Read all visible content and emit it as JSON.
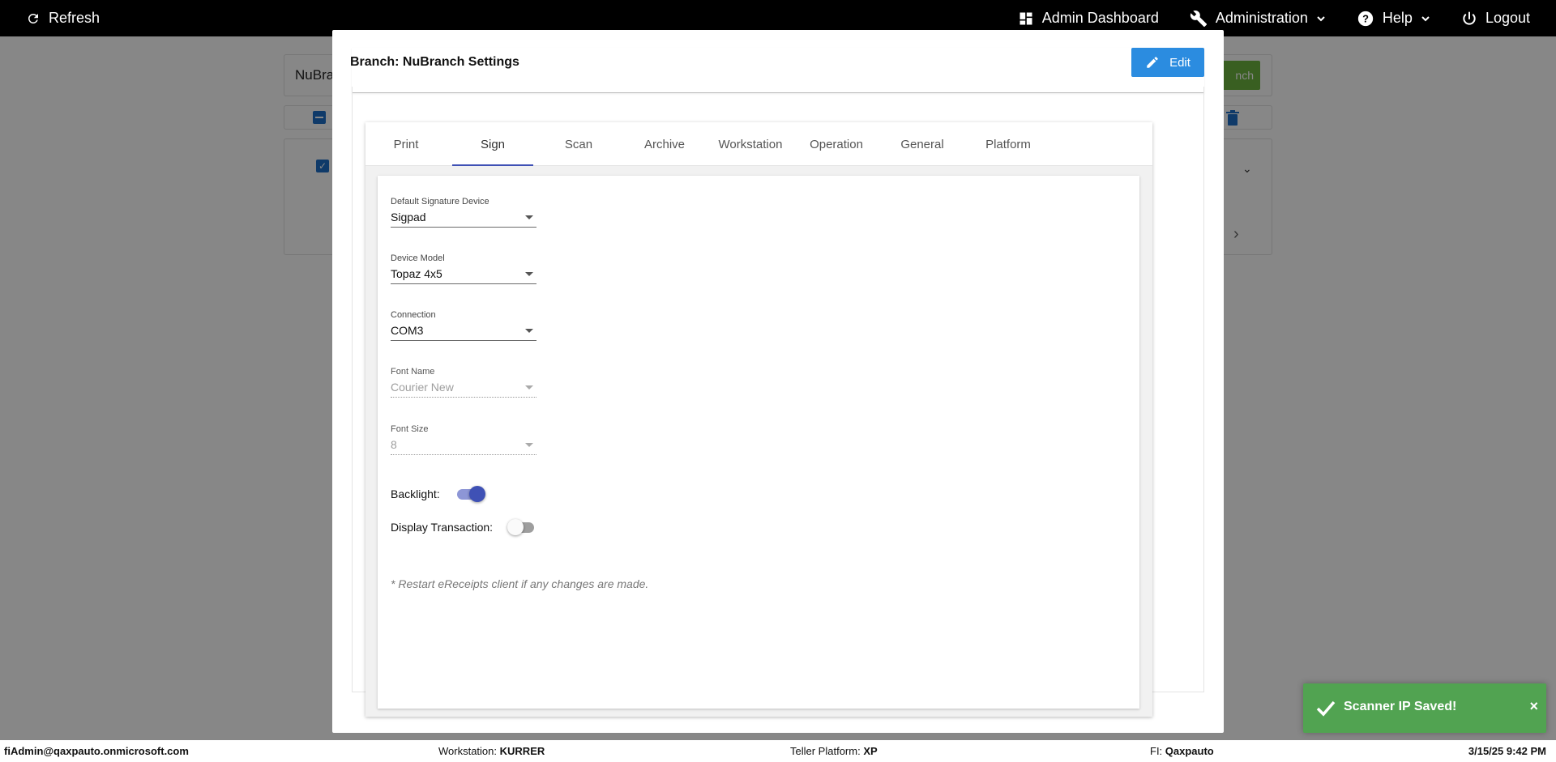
{
  "topbar": {
    "refresh_label": "Refresh",
    "admin_dashboard_label": "Admin Dashboard",
    "administration_label": "Administration",
    "help_label": "Help",
    "logout_label": "Logout"
  },
  "background": {
    "search_value": "NuBra",
    "green_button_label": "nch"
  },
  "modal": {
    "title": "Branch: NuBranch Settings",
    "edit_label": "Edit",
    "tabs": [
      {
        "label": "Print"
      },
      {
        "label": "Sign"
      },
      {
        "label": "Scan"
      },
      {
        "label": "Archive"
      },
      {
        "label": "Workstation"
      },
      {
        "label": "Operation"
      },
      {
        "label": "General"
      },
      {
        "label": "Platform"
      }
    ],
    "active_tab": "Sign",
    "fields": {
      "default_signature_device": {
        "label": "Default Signature Device",
        "value": "Sigpad"
      },
      "device_model": {
        "label": "Device Model",
        "value": "Topaz 4x5"
      },
      "connection": {
        "label": "Connection",
        "value": "COM3"
      },
      "font_name": {
        "label": "Font Name",
        "value": "Courier New"
      },
      "font_size": {
        "label": "Font Size",
        "value": "8"
      }
    },
    "toggles": {
      "backlight": {
        "label": "Backlight:",
        "on": true
      },
      "display_transaction": {
        "label": "Display Transaction:",
        "on": false
      }
    },
    "note": "* Restart eReceipts client if any changes are made."
  },
  "toast": {
    "message": "Scanner IP Saved!",
    "close": "×",
    "color": "#51a351"
  },
  "footer": {
    "user": "fiAdmin@qaxpauto.onmicrosoft.com",
    "workstation_label": "Workstation:",
    "workstation_value": "KURRER",
    "teller_platform_label": "Teller Platform:",
    "teller_platform_value": "XP",
    "fi_label": "FI:",
    "fi_value": "Qaxpauto",
    "datetime": "3/15/25 9:42 PM"
  },
  "colors": {
    "accent": "#3f51b5",
    "edit_button": "#2b8ce0",
    "topbar": "#000000"
  }
}
